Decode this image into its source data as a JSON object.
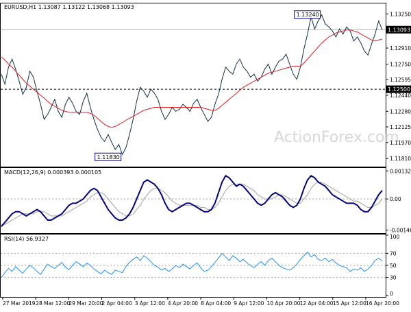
{
  "chart_data": [
    {
      "type": "line",
      "panel": "price",
      "header": "EURUSD,H1  1.13087 1.13122 1.13068 1.13093",
      "watermark": "ActionForex.com",
      "y_ticks": [
        "1.13250",
        "1.12910",
        "1.12750",
        "1.12595",
        "1.12440",
        "1.12280",
        "1.12125",
        "1.11970",
        "1.11810"
      ],
      "ylim": [
        1.1175,
        1.1332
      ],
      "last_price_label": "1.13093",
      "last_price": 1.13093,
      "support_label": "1.12500",
      "support_level": 1.125,
      "high_label": "1.13240",
      "high_value": 1.1324,
      "low_label": "1.11830",
      "low_value": 1.1183,
      "series": [
        {
          "name": "",
          "color": "#0f2f44",
          "values": [
            1.1265,
            1.1255,
            1.1272,
            1.128,
            1.127,
            1.1258,
            1.1245,
            1.1252,
            1.1268,
            1.1262,
            1.1248,
            1.1235,
            1.122,
            1.1225,
            1.1232,
            1.124,
            1.1228,
            1.1222,
            1.1235,
            1.1242,
            1.1236,
            1.1228,
            1.1225,
            1.1238,
            1.1246,
            1.1232,
            1.122,
            1.121,
            1.1202,
            1.1198,
            1.1205,
            1.1197,
            1.119,
            1.1195,
            1.1185,
            1.1192,
            1.1205,
            1.122,
            1.1238,
            1.1252,
            1.1248,
            1.1242,
            1.125,
            1.1246,
            1.124,
            1.1228,
            1.122,
            1.1225,
            1.1232,
            1.1228,
            1.123,
            1.1235,
            1.1232,
            1.1228,
            1.1236,
            1.124,
            1.1232,
            1.1225,
            1.1218,
            1.1222,
            1.1235,
            1.1245,
            1.126,
            1.1272,
            1.1268,
            1.1265,
            1.1275,
            1.128,
            1.1272,
            1.1268,
            1.1262,
            1.1265,
            1.1258,
            1.1262,
            1.127,
            1.1275,
            1.1265,
            1.1272,
            1.1278,
            1.128,
            1.1285,
            1.1275,
            1.1265,
            1.126,
            1.1272,
            1.129,
            1.1305,
            1.1322,
            1.131,
            1.1318,
            1.1324,
            1.1315,
            1.1312,
            1.1308,
            1.1302,
            1.131,
            1.1305,
            1.1312,
            1.1308,
            1.1298,
            1.1302,
            1.1296,
            1.1288,
            1.1284,
            1.1295,
            1.1305,
            1.1318,
            1.1309
          ]
        },
        {
          "name": "",
          "color": "#e41a1c",
          "values": [
            1.1282,
            1.1279,
            1.1275,
            1.1272,
            1.1268,
            1.1264,
            1.126,
            1.1256,
            1.1253,
            1.125,
            1.1247,
            1.1244,
            1.1241,
            1.1238,
            1.1235,
            1.1233,
            1.1231,
            1.1229,
            1.1228,
            1.1227,
            1.1227,
            1.1227,
            1.1227,
            1.1227,
            1.1227,
            1.1226,
            1.1224,
            1.1221,
            1.1218,
            1.1215,
            1.1213,
            1.1212,
            1.1213,
            1.1215,
            1.1217,
            1.1219,
            1.1221,
            1.1223,
            1.1225,
            1.1227,
            1.1229,
            1.123,
            1.1231,
            1.1232,
            1.1232,
            1.1232,
            1.1232,
            1.1232,
            1.1232,
            1.1232,
            1.1232,
            1.1232,
            1.1232,
            1.1232,
            1.1232,
            1.1232,
            1.1232,
            1.1231,
            1.123,
            1.1229,
            1.1229,
            1.1231,
            1.1234,
            1.1237,
            1.124,
            1.1243,
            1.1246,
            1.1249,
            1.1252,
            1.1254,
            1.1256,
            1.1258,
            1.126,
            1.1262,
            1.1264,
            1.1266,
            1.1267,
            1.1268,
            1.1269,
            1.127,
            1.1271,
            1.1272,
            1.1273,
            1.1273,
            1.1273,
            1.1276,
            1.128,
            1.1284,
            1.1288,
            1.1292,
            1.1296,
            1.1299,
            1.1302,
            1.1304,
            1.1306,
            1.1307,
            1.1308,
            1.1309,
            1.1309,
            1.1308,
            1.1307,
            1.1305,
            1.1303,
            1.1301,
            1.1299,
            1.1298,
            1.1299,
            1.13
          ]
        }
      ]
    },
    {
      "type": "line",
      "panel": "macd",
      "header": "MACD(12,26,9) 0.000393 0.000105",
      "y_ticks": [
        "0.001327",
        "0.00",
        "-0.001469"
      ],
      "ylim": [
        -0.00155,
        0.0014
      ],
      "series": [
        {
          "name": "",
          "color": "#00007f",
          "values": [
            -0.0013,
            -0.0011,
            -0.0009,
            -0.0007,
            -0.0006,
            -0.0006,
            -0.0007,
            -0.0008,
            -0.0007,
            -0.0006,
            -0.0005,
            -0.0006,
            -0.0008,
            -0.001,
            -0.001,
            -0.0009,
            -0.0008,
            -0.0007,
            -0.0005,
            -0.0003,
            -0.0002,
            -0.0002,
            -0.0001,
            0.0,
            0.0002,
            0.0004,
            0.0005,
            0.0004,
            0.0001,
            -0.0002,
            -0.0005,
            -0.0007,
            -0.0009,
            -0.001,
            -0.001,
            -0.0009,
            -0.0007,
            -0.0004,
            0.0,
            0.0004,
            0.0008,
            0.0009,
            0.0008,
            0.0007,
            0.0005,
            0.0002,
            -0.0002,
            -0.0005,
            -0.0006,
            -0.0005,
            -0.0004,
            -0.0003,
            -0.0002,
            -0.0002,
            -0.0003,
            -0.0004,
            -0.0005,
            -0.0006,
            -0.0006,
            -0.0005,
            -0.0002,
            0.0003,
            0.0008,
            0.0011,
            0.001,
            0.0008,
            0.0006,
            0.0007,
            0.0006,
            0.0004,
            0.0002,
            0.0,
            -0.0002,
            -0.0003,
            -0.0002,
            0.0,
            0.0002,
            0.0003,
            0.0002,
            0.0001,
            -0.0001,
            -0.0003,
            -0.0004,
            -0.0003,
            0.0,
            0.0005,
            0.0009,
            0.0011,
            0.001,
            0.0008,
            0.0007,
            0.0006,
            0.0004,
            0.0002,
            0.0001,
            0.0,
            -0.0001,
            -0.0002,
            -0.0002,
            -0.0002,
            -0.0003,
            -0.0005,
            -0.0006,
            -0.0006,
            -0.0004,
            -0.0001,
            0.0002,
            0.0004
          ]
        },
        {
          "name": "",
          "color": "#a0a0a0",
          "values": [
            -0.0012,
            -0.0012,
            -0.0011,
            -0.001,
            -0.0009,
            -0.0008,
            -0.0007,
            -0.0007,
            -0.0007,
            -0.0007,
            -0.0006,
            -0.0006,
            -0.0006,
            -0.0007,
            -0.0008,
            -0.0008,
            -0.0008,
            -0.0008,
            -0.0007,
            -0.0006,
            -0.0005,
            -0.0004,
            -0.0003,
            -0.0002,
            -0.0001,
            0.0001,
            0.0002,
            0.0003,
            0.0003,
            0.0002,
            0.0,
            -0.0002,
            -0.0004,
            -0.0006,
            -0.0007,
            -0.0008,
            -0.0008,
            -0.0007,
            -0.0005,
            -0.0003,
            0.0,
            0.0002,
            0.0004,
            0.0005,
            0.0005,
            0.0004,
            0.0003,
            0.0001,
            -0.0001,
            -0.0002,
            -0.0003,
            -0.0003,
            -0.0003,
            -0.0003,
            -0.0003,
            -0.0003,
            -0.0004,
            -0.0004,
            -0.0005,
            -0.0005,
            -0.0004,
            -0.0002,
            0.0001,
            0.0004,
            0.0006,
            0.0007,
            0.0007,
            0.0007,
            0.0007,
            0.0006,
            0.0005,
            0.0004,
            0.0002,
            0.0001,
            0.0,
            0.0,
            0.0,
            0.0001,
            0.0002,
            0.0002,
            0.0001,
            0.0,
            -0.0001,
            -0.0002,
            -0.0002,
            0.0,
            0.0002,
            0.0005,
            0.0007,
            0.0008,
            0.0008,
            0.0007,
            0.0006,
            0.0005,
            0.0004,
            0.0003,
            0.0002,
            0.0001,
            0.0,
            -0.0001,
            -0.0001,
            -0.0002,
            -0.0003,
            -0.0004,
            -0.0004,
            -0.0003,
            -0.0002,
            0.0
          ]
        }
      ]
    },
    {
      "type": "line",
      "panel": "rsi",
      "header": "RSI(14) 56.9327",
      "y_ticks": [
        "100",
        "70",
        "50",
        "30",
        "0"
      ],
      "levels": [
        70,
        50,
        30
      ],
      "ylim": [
        0,
        100
      ],
      "series": [
        {
          "name": "",
          "color": "#1e90ff",
          "values": [
            30,
            38,
            45,
            40,
            48,
            42,
            37,
            44,
            50,
            46,
            40,
            35,
            44,
            52,
            48,
            45,
            50,
            55,
            47,
            43,
            50,
            56,
            52,
            48,
            54,
            50,
            44,
            40,
            36,
            42,
            38,
            35,
            42,
            40,
            38,
            48,
            55,
            60,
            64,
            58,
            66,
            62,
            56,
            50,
            47,
            42,
            45,
            40,
            44,
            50,
            46,
            52,
            48,
            44,
            50,
            54,
            46,
            40,
            42,
            48,
            55,
            62,
            70,
            64,
            58,
            66,
            62,
            56,
            60,
            54,
            50,
            46,
            52,
            56,
            50,
            58,
            62,
            56,
            50,
            46,
            44,
            42,
            46,
            52,
            60,
            66,
            72,
            64,
            68,
            60,
            58,
            62,
            56,
            60,
            54,
            50,
            48,
            46,
            40,
            44,
            42,
            46,
            40,
            44,
            50,
            58,
            62,
            57
          ]
        }
      ]
    }
  ],
  "x_axis": {
    "labels": [
      "27 Mar 2019",
      "28 Mar 12:00",
      "29 Mar 20:00",
      "2 Apr 04:00",
      "3 Apr 12:00",
      "4 Apr 20:00",
      "8 Apr 04:00",
      "9 Apr 12:00",
      "10 Apr 20:00",
      "12 Apr 04:00",
      "15 Apr 12:00",
      "16 Apr 20:00"
    ]
  }
}
